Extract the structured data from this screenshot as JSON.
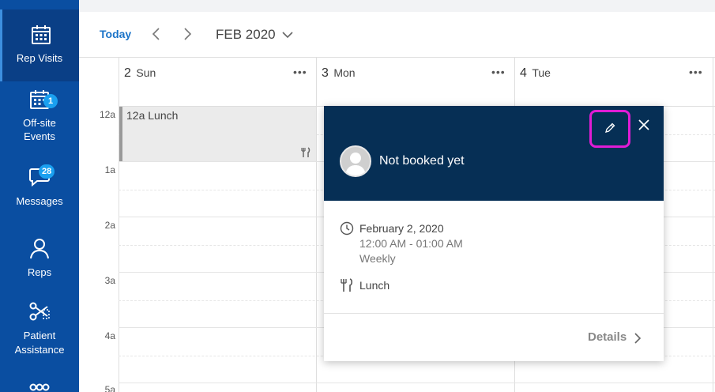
{
  "sidebar": {
    "items": [
      {
        "label": "Rep Visits",
        "icon": "calendar-icon",
        "badge": null,
        "active": true
      },
      {
        "label_line1": "Off-site",
        "label_line2": "Events",
        "icon": "event-calendar-icon",
        "badge": "1"
      },
      {
        "label": "Messages",
        "icon": "chat-bubble-icon",
        "badge": "28"
      },
      {
        "label": "Reps",
        "icon": "person-icon",
        "badge": null
      },
      {
        "label_line1": "Patient",
        "label_line2": "Assistance",
        "icon": "scissors-icon",
        "badge": null
      },
      {
        "icon": "group-icon"
      }
    ],
    "bg_color": "#0a4ea1",
    "active_color": "#0a3f86",
    "badge_color": "#1aa0f0"
  },
  "toolbar": {
    "today_label": "Today",
    "month_label": "FEB 2020"
  },
  "calendar": {
    "days": [
      {
        "num": "2",
        "weekday": "Sun"
      },
      {
        "num": "3",
        "weekday": "Mon"
      },
      {
        "num": "4",
        "weekday": "Tue"
      }
    ],
    "more_label": "•••",
    "time_labels": [
      "12a",
      "1a",
      "2a",
      "3a",
      "4a",
      "5a"
    ],
    "event": {
      "title": "12a Lunch",
      "icon": "fork-knife-icon"
    }
  },
  "popover": {
    "status": "Not booked yet",
    "date": "February 2, 2020",
    "time_range": "12:00 AM - 01:00 AM",
    "recurrence": "Weekly",
    "type": "Lunch",
    "details_label": "Details",
    "header_color": "#062f55",
    "highlight_color": "#e01cd5"
  }
}
